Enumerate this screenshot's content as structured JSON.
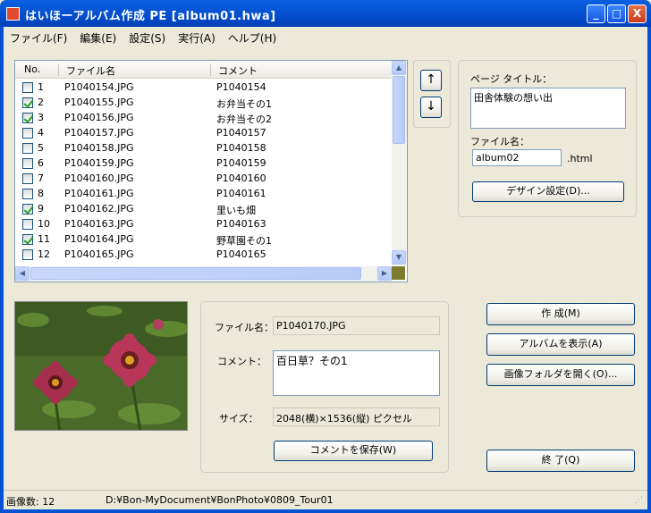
{
  "window": {
    "title": "はいほーアルバム作成 PE [album01.hwa]",
    "minimize_label": "_",
    "maximize_label": "□",
    "close_label": "X"
  },
  "menu": [
    "ファイル(F)",
    "編集(E)",
    "設定(S)",
    "実行(A)",
    "ヘルプ(H)"
  ],
  "list": {
    "columns": [
      "No.",
      "ファイル名",
      "コメント"
    ],
    "rows": [
      {
        "checked": false,
        "no": "1",
        "file": "P1040154.JPG",
        "comment": "P1040154"
      },
      {
        "checked": true,
        "no": "2",
        "file": "P1040155.JPG",
        "comment": "お弁当その1"
      },
      {
        "checked": true,
        "no": "3",
        "file": "P1040156.JPG",
        "comment": "お弁当その2"
      },
      {
        "checked": false,
        "no": "4",
        "file": "P1040157.JPG",
        "comment": "P1040157"
      },
      {
        "checked": false,
        "no": "5",
        "file": "P1040158.JPG",
        "comment": "P1040158"
      },
      {
        "checked": false,
        "no": "6",
        "file": "P1040159.JPG",
        "comment": "P1040159"
      },
      {
        "checked": false,
        "no": "7",
        "file": "P1040160.JPG",
        "comment": "P1040160"
      },
      {
        "checked": false,
        "no": "8",
        "file": "P1040161.JPG",
        "comment": "P1040161"
      },
      {
        "checked": true,
        "no": "9",
        "file": "P1040162.JPG",
        "comment": "里いも畑"
      },
      {
        "checked": false,
        "no": "10",
        "file": "P1040163.JPG",
        "comment": "P1040163"
      },
      {
        "checked": true,
        "no": "11",
        "file": "P1040164.JPG",
        "comment": "野草園その1"
      },
      {
        "checked": false,
        "no": "12",
        "file": "P1040165.JPG",
        "comment": "P1040165"
      }
    ]
  },
  "move": {
    "up_label": "↑",
    "down_label": "↓"
  },
  "page": {
    "title_label": "ページ タイトル：",
    "title_value": "田舎体験の想い出",
    "file_label": "ファイル名：",
    "file_value": "album02",
    "ext": ".html",
    "design_button": "デザイン設定(D)..."
  },
  "detail": {
    "file_label": "ファイル名：",
    "file_value": "P1040170.JPG",
    "comment_label": "コメント：",
    "comment_value": "百日草？その1",
    "size_label": "サイズ：",
    "size_value": "2048(横)×1536(縦) ピクセル",
    "save_button": "コメントを保存(W)"
  },
  "actions": {
    "create": "作 成(M)",
    "show_album": "アルバムを表示(A)",
    "open_folder": "画像フォルダを開く(O)...",
    "exit": "終 了(Q)"
  },
  "status": {
    "count": "画像数: 12",
    "path": "D:¥Bon-MyDocument¥BonPhoto¥0809_Tour01"
  }
}
